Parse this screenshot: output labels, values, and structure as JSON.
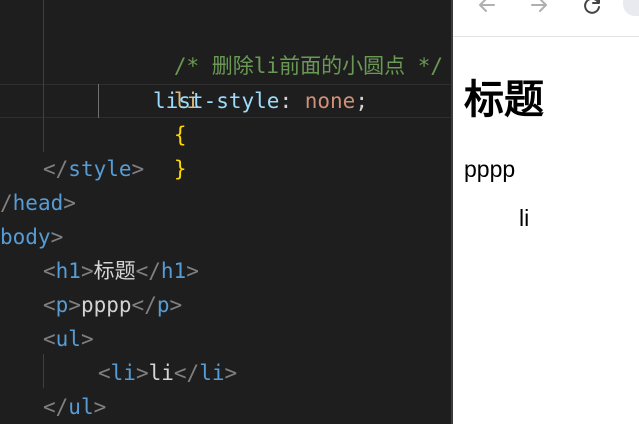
{
  "editor": {
    "line1": {
      "comment": "/* 删除li前面的小圆点 */"
    },
    "line2": {
      "selector": "li",
      "brace_open": "{"
    },
    "line3": {
      "property": "list-style",
      "colon": ":",
      "value": "none",
      "semicolon": ";"
    },
    "line4": {
      "brace_close": "}"
    },
    "line5": {
      "open_bracket": "</",
      "tag": "style",
      "close_bracket": ">"
    },
    "line6": {
      "open_bracket": "/",
      "tag": "head",
      "close_bracket": ">"
    },
    "line7": {
      "tag": "body",
      "close_bracket": ">"
    },
    "line8": {
      "open_bracket": "<",
      "tag": "h1",
      "mid_bracket": ">",
      "text": "标题",
      "close_open_bracket": "</",
      "close_tag": "h1",
      "close_bracket": ">"
    },
    "line9": {
      "open_bracket": "<",
      "tag": "p",
      "mid_bracket": ">",
      "text": "pppp",
      "close_open_bracket": "</",
      "close_tag": "p",
      "close_bracket": ">"
    },
    "line10": {
      "open_bracket": "<",
      "tag": "ul",
      "close_bracket": ">"
    },
    "line11": {
      "open_bracket": "<",
      "tag": "li",
      "mid_bracket": ">",
      "text": "li",
      "close_open_bracket": "</",
      "close_tag": "li",
      "close_bracket": ">"
    },
    "line12": {
      "open_bracket": "</",
      "tag": "ul",
      "close_bracket": ">"
    }
  },
  "browser": {
    "toolbar": {
      "back_icon": "arrow-left-icon",
      "forward_icon": "arrow-right-icon",
      "reload_icon": "reload-icon"
    },
    "page": {
      "heading": "标题",
      "paragraph": "pppp",
      "list_item": "li"
    }
  },
  "colors": {
    "editor_background": "#1e1e1e",
    "comment": "#6a9955",
    "selector": "#d7ba7d",
    "brace": "#ffd700",
    "property": "#9cdcfe",
    "value": "#ce9178",
    "tag": "#569cd6",
    "bracket": "#808080",
    "browser_background": "#ffffff"
  }
}
